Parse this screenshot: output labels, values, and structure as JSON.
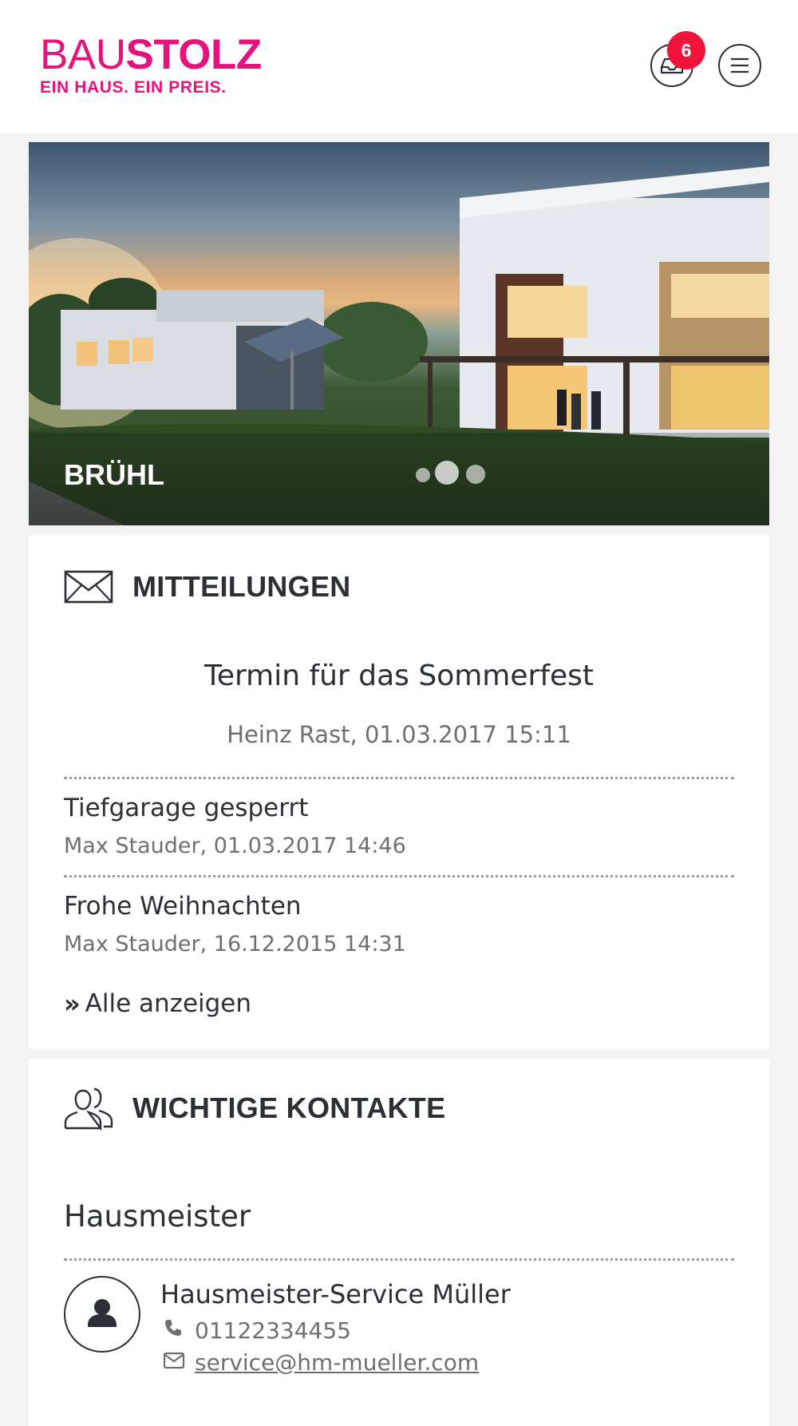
{
  "header": {
    "logo_light": "BAU",
    "logo_bold": "STOLZ",
    "logo_tagline": "EIN HAUS. EIN PREIS.",
    "notification_count": "6",
    "brand_color": "#e5137b",
    "badge_color": "#f0143c"
  },
  "hero": {
    "title": "BRÜHL",
    "slides_count": 3,
    "active_slide": 1
  },
  "messages": {
    "title": "MITTEILUNGEN",
    "icon": "envelope-icon",
    "featured": {
      "title": "Termin für das Sommerfest",
      "meta": "Heinz Rast, 01.03.2017 15:11"
    },
    "items": [
      {
        "title": "Tiefgarage gesperrt",
        "meta": "Max Stauder, 01.03.2017 14:46"
      },
      {
        "title": "Frohe Weihnachten",
        "meta": "Max Stauder, 16.12.2015 14:31"
      }
    ],
    "show_all": "Alle anzeigen"
  },
  "contacts": {
    "title": "WICHTIGE KONTAKTE",
    "icon": "people-icon",
    "groups": [
      {
        "name": "Hausmeister",
        "contacts": [
          {
            "name": "Hausmeister-Service Müller",
            "phone": "01122334455",
            "email": "service@hm-mueller.com"
          }
        ]
      }
    ]
  }
}
